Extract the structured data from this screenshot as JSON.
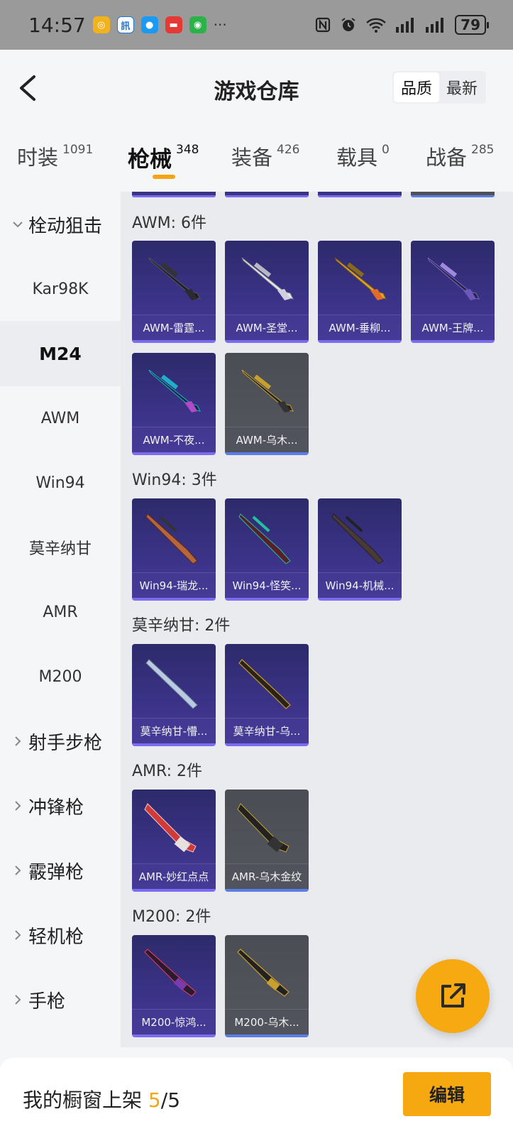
{
  "status_bar": {
    "time": "14:57",
    "battery": "79",
    "notification_icons": [
      "app-icon",
      "news-icon",
      "message-icon",
      "mail-icon",
      "wechat-icon"
    ],
    "overflow": "···"
  },
  "header": {
    "title": "游戏仓库",
    "sort_options": [
      "品质",
      "最新"
    ],
    "sort_active": "品质"
  },
  "category_tabs": [
    {
      "label": "时装",
      "count": "1091"
    },
    {
      "label": "枪械",
      "count": "348",
      "active": true
    },
    {
      "label": "装备",
      "count": "426"
    },
    {
      "label": "载具",
      "count": "0"
    },
    {
      "label": "战备",
      "count": "285"
    }
  ],
  "sidebar": {
    "group_open": "栓动狙击",
    "items": [
      "Kar98K",
      "M24",
      "AWM",
      "Win94",
      "莫辛纳甘",
      "AMR",
      "M200"
    ],
    "active_item": "M24",
    "collapsed_groups": [
      "射手步枪",
      "冲锋枪",
      "霰弹枪",
      "轻机枪",
      "手枪"
    ]
  },
  "sections": [
    {
      "title": "AWM: 6件",
      "items": [
        {
          "name": "AWM-雷霆...",
          "quality": "purple"
        },
        {
          "name": "AWM-圣堂...",
          "quality": "purple"
        },
        {
          "name": "AWM-垂柳...",
          "quality": "purple"
        },
        {
          "name": "AWM-王牌...",
          "quality": "purple"
        },
        {
          "name": "AWM-不夜...",
          "quality": "purple"
        },
        {
          "name": "AWM-乌木...",
          "quality": "gray"
        }
      ]
    },
    {
      "title": "Win94: 3件",
      "items": [
        {
          "name": "Win94-瑞龙...",
          "quality": "purple"
        },
        {
          "name": "Win94-怪笑...",
          "quality": "purple"
        },
        {
          "name": "Win94-机械...",
          "quality": "purple"
        }
      ]
    },
    {
      "title": "莫辛纳甘: 2件",
      "items": [
        {
          "name": "莫辛纳甘-懵...",
          "quality": "purple"
        },
        {
          "name": "莫辛纳甘-乌...",
          "quality": "purple"
        }
      ]
    },
    {
      "title": "AMR: 2件",
      "items": [
        {
          "name": "AMR-妙红点点",
          "quality": "purple"
        },
        {
          "name": "AMR-乌木金纹",
          "quality": "gray"
        }
      ]
    },
    {
      "title": "M200: 2件",
      "items": [
        {
          "name": "M200-惊鸿...",
          "quality": "purple"
        },
        {
          "name": "M200-乌木...",
          "quality": "gray"
        }
      ]
    }
  ],
  "bottom_bar": {
    "label": "我的橱窗上架",
    "current": "5",
    "separator": "/",
    "total": "5",
    "edit_label": "编辑"
  },
  "colors": {
    "accent": "#f6a811",
    "purple_quality": "#7b6cf0",
    "gray_quality": "#5b7de6"
  }
}
